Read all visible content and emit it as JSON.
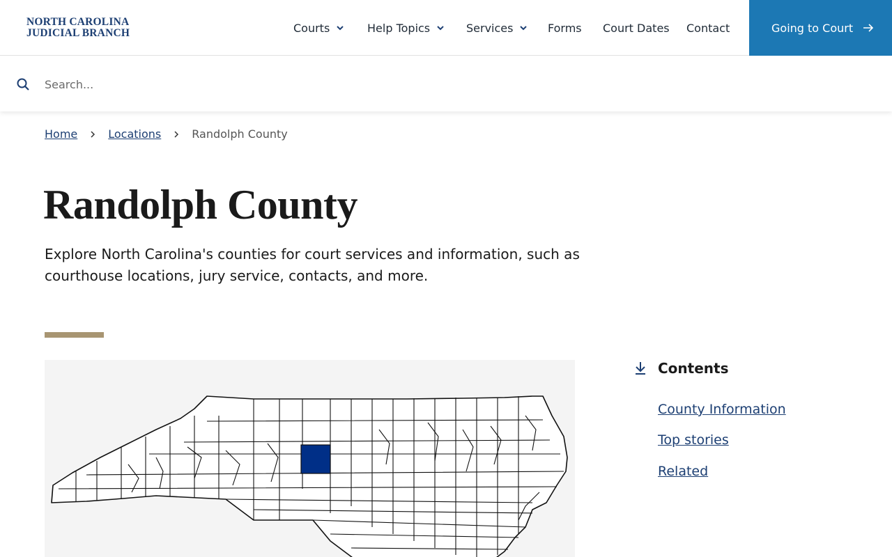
{
  "header": {
    "logo_line1": "NORTH CAROLINA",
    "logo_line2": "JUDICIAL BRANCH",
    "nav": [
      {
        "label": "Courts",
        "has_dropdown": true
      },
      {
        "label": "Help Topics",
        "has_dropdown": true
      },
      {
        "label": "Services",
        "has_dropdown": true
      },
      {
        "label": "Forms",
        "has_dropdown": false
      },
      {
        "label": "Court Dates",
        "has_dropdown": false
      },
      {
        "label": "Contact",
        "has_dropdown": false
      }
    ],
    "cta_label": "Going to Court",
    "cta_color": "#1c78b4"
  },
  "search": {
    "placeholder": "Search...",
    "value": ""
  },
  "breadcrumb": {
    "items": [
      "Home",
      "Locations"
    ],
    "current": "Randolph County"
  },
  "main": {
    "title": "Randolph County",
    "intro": "Explore North Carolina's counties for court services and information, such as courthouse locations, jury service, contacts, and more.",
    "accent_color": "#a89572",
    "highlight_color": "#002f87"
  },
  "contents": {
    "heading": "Contents",
    "links": [
      "County Information",
      "Top stories",
      "Related"
    ]
  },
  "icons": {
    "search": "search-icon",
    "chevron": "chevron-down-icon",
    "arrow": "arrow-right-icon",
    "contents": "arrow-down-to-line-icon"
  }
}
